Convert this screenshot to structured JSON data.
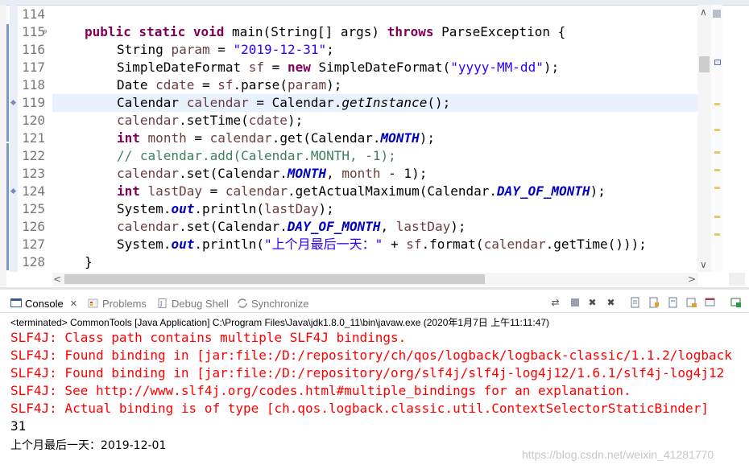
{
  "editor": {
    "lines": [
      {
        "no": "114"
      },
      {
        "no": "115"
      },
      {
        "no": "116"
      },
      {
        "no": "117"
      },
      {
        "no": "118"
      },
      {
        "no": "119"
      },
      {
        "no": "120"
      },
      {
        "no": "121"
      },
      {
        "no": "122"
      },
      {
        "no": "123"
      },
      {
        "no": "124"
      },
      {
        "no": "125"
      },
      {
        "no": "126"
      },
      {
        "no": "127"
      },
      {
        "no": "128"
      }
    ],
    "code": {
      "l115": {
        "k1": "public static void",
        "t1": " main(String[] args) ",
        "k2": "throws",
        "t2": " ParseException {"
      },
      "l116": {
        "t1": "String ",
        "v1": "param",
        "t2": " = ",
        "s1": "\"2019-12-31\"",
        "t3": ";"
      },
      "l117": {
        "t1": "SimpleDateFormat ",
        "v1": "sf",
        "t2": " = ",
        "k1": "new",
        "t3": " SimpleDateFormat(",
        "s1": "\"yyyy-MM-dd\"",
        "t4": ");"
      },
      "l118": {
        "t1": "Date ",
        "v1": "cdate",
        "t2": " = ",
        "v2": "sf",
        "t3": ".parse(",
        "v3": "param",
        "t4": ");"
      },
      "l119": {
        "t1": "Calendar ",
        "v1": "calendar",
        "t2": " = Calendar.",
        "i1": "getInstance",
        "t3": "();"
      },
      "l120": {
        "v1": "calendar",
        "t1": ".setTime(",
        "v2": "cdate",
        "t2": ");"
      },
      "l121": {
        "k1": "int",
        "t0": " ",
        "v1": "month",
        "t1": " = ",
        "v2": "calendar",
        "t2": ".get(Calendar.",
        "f1": "MONTH",
        "t3": ");"
      },
      "l122": {
        "c1": "// calendar.add(Calendar.MONTH, -1);"
      },
      "l123": {
        "v1": "calendar",
        "t1": ".set(Calendar.",
        "f1": "MONTH",
        "t2": ", ",
        "v2": "month",
        "t3": " - 1);"
      },
      "l124": {
        "k1": "int",
        "t0": " ",
        "v1": "lastDay",
        "t1": " = ",
        "v2": "calendar",
        "t2": ".getActualMaximum(Calendar.",
        "f1": "DAY_OF_MONTH",
        "t3": ");"
      },
      "l125": {
        "t1": "System.",
        "f1": "out",
        "t2": ".println(",
        "v1": "lastDay",
        "t3": ");"
      },
      "l126": {
        "v1": "calendar",
        "t1": ".set(Calendar.",
        "f1": "DAY_OF_MONTH",
        "t2": ", ",
        "v2": "lastDay",
        "t3": ");"
      },
      "l127": {
        "t1": "System.",
        "f1": "out",
        "t2": ".println(",
        "s1": "\"上个月最后一天：\"",
        "t3": " + ",
        "v1": "sf",
        "t4": ".format(",
        "v2": "calendar",
        "t5": ".getTime()));"
      },
      "l128": {
        "t1": "}"
      }
    }
  },
  "views": {
    "tabs": [
      {
        "label": "Console",
        "active": true
      },
      {
        "label": "Problems"
      },
      {
        "label": "Debug Shell"
      },
      {
        "label": "Synchronize"
      }
    ],
    "close_glyph": "✕"
  },
  "console": {
    "title": "<terminated> CommonTools [Java Application] C:\\Program Files\\Java\\jdk1.8.0_11\\bin\\javaw.exe (2020年1月7日 上午11:11:47)",
    "lines": [
      "SLF4J: Class path contains multiple SLF4J bindings.",
      "SLF4J: Found binding in [jar:file:/D:/repository/ch/qos/logback/logback-classic/1.1.2/logback",
      "SLF4J: Found binding in [jar:file:/D:/repository/org/slf4j/slf4j-log4j12/1.6.1/slf4j-log4j12",
      "SLF4J: See http://www.slf4j.org/codes.html#multiple_bindings for an explanation.",
      "SLF4J: Actual binding is of type [ch.qos.logback.classic.util.ContextSelectorStaticBinder]",
      "31"
    ],
    "last": "上个月最后一天：2019-12-01"
  },
  "watermark": "https://blog.csdn.net/weixin_41281770",
  "colors": {
    "keyword": "#7f0055",
    "string": "#2a00ff",
    "field": "#0000c0",
    "error": "#ff0000"
  }
}
